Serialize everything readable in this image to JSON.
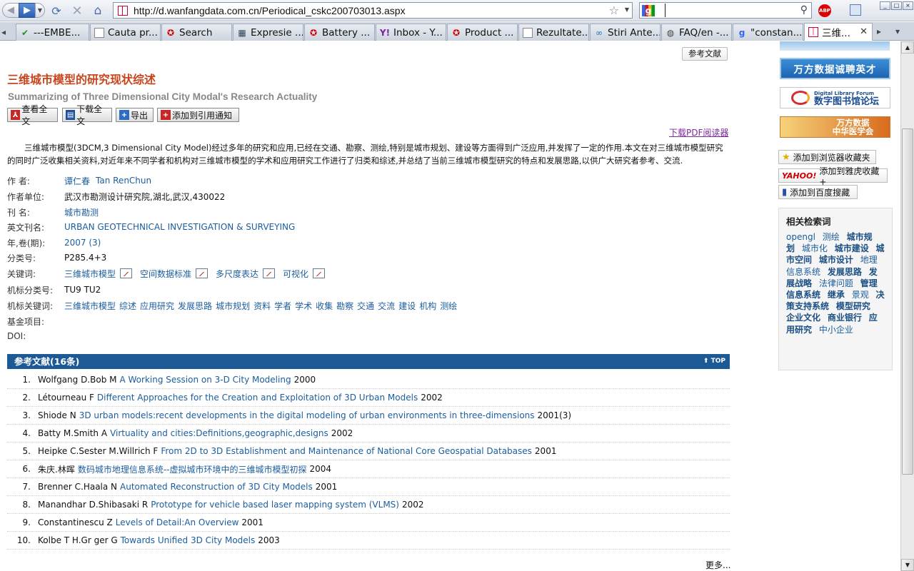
{
  "browser": {
    "url": "http://d.wanfangdata.com.cn/Periodical_cskc200703013.aspx",
    "search_value": "",
    "tabs": [
      {
        "label": "---EMBE...",
        "icon": "check-icon"
      },
      {
        "label": "Cauta pr...",
        "icon": "page-icon"
      },
      {
        "label": "Search",
        "icon": "acrobat-icon"
      },
      {
        "label": "Expresie ...",
        "icon": "dict-icon"
      },
      {
        "label": "Battery ...",
        "icon": "acrobat-icon"
      },
      {
        "label": "Inbox - Y...",
        "icon": "yahoo-icon"
      },
      {
        "label": "Product ...",
        "icon": "acrobat-icon"
      },
      {
        "label": "Rezultate...",
        "icon": "page-icon"
      },
      {
        "label": "Stiri Ante...",
        "icon": "link-icon"
      },
      {
        "label": "FAQ/en -...",
        "icon": "wiki-icon"
      },
      {
        "label": "\"constan...",
        "icon": "google-icon"
      },
      {
        "label": "三维...",
        "icon": "wanfang-icon"
      }
    ]
  },
  "page": {
    "ref_tab_label": "参考文献",
    "title": "三维城市模型的研究现状综述",
    "subtitle": "Summarizing of Three Dimensional City Modal's Research Actuality",
    "actions": {
      "view_full": "查看全文",
      "download_full": "下载全文",
      "export": "导出",
      "add_alert": "添加到引用通知"
    },
    "pdf_reader": "下载PDF阅读器",
    "abstract": "三维城市模型(3DCM,3 Dimensional City Model)经过多年的研究和应用,已经在交通、勘察、测绘,特别是城市规划、建设等方面得到广泛应用,并发挥了一定的作用.本文在对三维城市模型研究的同时广泛收集相关资料,对近年来不同学者和机构对三维城市模型的学术和应用研究工作进行了归类和综述,并总结了当前三维城市模型研究的特点和发展思路,以供广大研究者参考、交流.",
    "meta": {
      "author_label": "作 者:",
      "author_cn": "谭仁春",
      "author_en": "Tan RenChun",
      "unit_label": "作者单位:",
      "unit": "武汉市勘测设计研究院,湖北,武汉,430022",
      "journal_label": "刊 名:",
      "journal": "城市勘测",
      "journal_en_label": "英文刊名:",
      "journal_en": "URBAN GEOTECHNICAL INVESTIGATION & SURVEYING",
      "year_label": "年,卷(期):",
      "year": "2007 (3)",
      "class_label": "分类号:",
      "class": "P285.4+3",
      "keywords_label": "关键词:",
      "keywords": [
        "三维城市模型",
        "空间数据标准",
        "多尺度表达",
        "可视化"
      ],
      "machine_class_label": "机标分类号:",
      "machine_class": "TU9 TU2",
      "machine_keywords_label": "机标关键词:",
      "machine_keywords": [
        "三维城市模型",
        "综述",
        "应用研究",
        "发展思路",
        "城市规划",
        "资料",
        "学者",
        "学术",
        "收集",
        "勘察",
        "交通",
        "交流",
        "建设",
        "机构",
        "测绘"
      ],
      "fund_label": "基金项目:",
      "doi_label": "DOI:"
    },
    "refs_header": "参考文献(16条)",
    "top_label": "TOP",
    "refs": [
      {
        "n": "1.",
        "authors": "Wolfgang D.Bob M",
        "title": "A Working Session on 3-D City Modeling",
        "year": "2000"
      },
      {
        "n": "2.",
        "authors": "Létourneau F",
        "title": "Different Approaches for the Creation and Exploitation of 3D Urban Models",
        "year": "2002"
      },
      {
        "n": "3.",
        "authors": "Shiode N",
        "title": "3D urban models:recent developments in the digital modeling of urban environments in three-dimensions",
        "year": "2001(3)"
      },
      {
        "n": "4.",
        "authors": "Batty M.Smith A",
        "title": "Virtuality and cities:Definitions,geographic,designs",
        "year": "2002"
      },
      {
        "n": "5.",
        "authors": "Heipke C.Sester M.Willrich F",
        "title": "From 2D to 3D Establishment and Maintenance of National Core Geospatial Databases",
        "year": "2001"
      },
      {
        "n": "6.",
        "authors": "朱庆.林晖",
        "title": "数码城市地理信息系统--虚拟城市环境中的三维城市模型初探",
        "year": "2004"
      },
      {
        "n": "7.",
        "authors": "Brenner C.Haala N",
        "title": "Automated Reconstruction of 3D City Models",
        "year": "2001"
      },
      {
        "n": "8.",
        "authors": "Manandhar D.Shibasaki R",
        "title": "Prototype for vehicle based laser mapping system (VLMS)",
        "year": "2002"
      },
      {
        "n": "9.",
        "authors": "Constantinescu Z",
        "title": "Levels of Detail:An Overview",
        "year": "2001"
      },
      {
        "n": "10.",
        "authors": "Kolbe T H.Gr ger G",
        "title": "Towards Unified 3D City Models",
        "year": "2003"
      }
    ],
    "more_label": "更多..."
  },
  "sidebar": {
    "banner_recruit": "万方数据诚聘英才",
    "banner_dlf": "数字图书馆论坛",
    "banner_dlf_small": "Digital Library Forum",
    "banner_cma_1": "万方数据",
    "banner_cma_2": "中华医学会",
    "fav_browser": "添加到浏览器收藏夹",
    "fav_yahoo": "添加到雅虎收藏+",
    "fav_baidu": "添加到百度搜藏",
    "related_title": "相关检索词",
    "related_terms": [
      {
        "t": "opengl",
        "b": false
      },
      {
        "t": "测绘",
        "b": false
      },
      {
        "t": "城市规划",
        "b": true
      },
      {
        "t": "城市化",
        "b": false
      },
      {
        "t": "城市建设",
        "b": true
      },
      {
        "t": "城市空间",
        "b": true
      },
      {
        "t": "城市设计",
        "b": true
      },
      {
        "t": "地理信息系统",
        "b": false
      },
      {
        "t": "发展思路",
        "b": true
      },
      {
        "t": "发展战略",
        "b": true
      },
      {
        "t": "法律问题",
        "b": false
      },
      {
        "t": "管理信息系统",
        "b": true
      },
      {
        "t": "继承",
        "b": true
      },
      {
        "t": "景观",
        "b": false
      },
      {
        "t": "决策支持系统",
        "b": true
      },
      {
        "t": "模型研究",
        "b": true
      },
      {
        "t": "企业文化",
        "b": true
      },
      {
        "t": "商业银行",
        "b": true
      },
      {
        "t": "应用研究",
        "b": true
      },
      {
        "t": "中小企业",
        "b": false
      }
    ]
  }
}
